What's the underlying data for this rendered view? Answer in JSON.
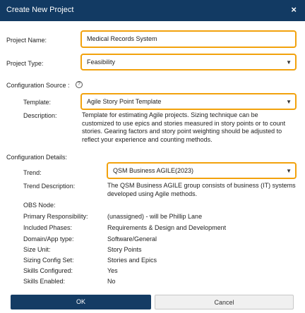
{
  "dialog": {
    "title": "Create New Project",
    "close_glyph": "×"
  },
  "project_name": {
    "label": "Project Name:",
    "value": "Medical Records System"
  },
  "project_type": {
    "label": "Project Type:",
    "value": "Feasibility"
  },
  "config_source": {
    "label": "Configuration Source :",
    "help_glyph": "?",
    "template_label": "Template:",
    "template_value": "Agile Story Point Template",
    "description_label": "Description:",
    "description_lines": [
      "Template for estimating Agile projects. Sizing technique can be",
      "customized to use epics and stories measured in story points or to count",
      "stories. Gearing factors and story point weighting should be adjusted to",
      "reflect your experience and counting methods."
    ]
  },
  "config_details": {
    "label": "Configuration Details:",
    "trend_label": "Trend:",
    "trend_value": "QSM Business AGILE(2023)",
    "trend_desc_label": "Trend Description:",
    "trend_desc_lines": [
      "The QSM Business AGILE group consists of business (IT) systems",
      "developed using Agile methods."
    ],
    "rows": [
      {
        "label": "OBS Node:",
        "value": ""
      },
      {
        "label": "Primary Responsibility:",
        "value": "(unassigned) - will be Phillip Lane"
      },
      {
        "label": "Included Phases:",
        "value": "Requirements & Design and Development"
      },
      {
        "label": "Domain/App type:",
        "value": "Software/General"
      },
      {
        "label": "Size Unit:",
        "value": "Story Points"
      },
      {
        "label": "Sizing Config Set:",
        "value": "Stories and Epics"
      },
      {
        "label": "Skills Configured:",
        "value": "Yes"
      },
      {
        "label": "Skills Enabled:",
        "value": "No"
      }
    ]
  },
  "buttons": {
    "ok": "OK",
    "cancel": "Cancel"
  },
  "icons": {
    "dropdown": "dropdown-caret-icon",
    "help": "help-circle-icon",
    "close": "close-icon"
  },
  "colors": {
    "titlebar": "#123a63",
    "focus_border": "#f2a20d",
    "ok_button": "#143c64"
  }
}
